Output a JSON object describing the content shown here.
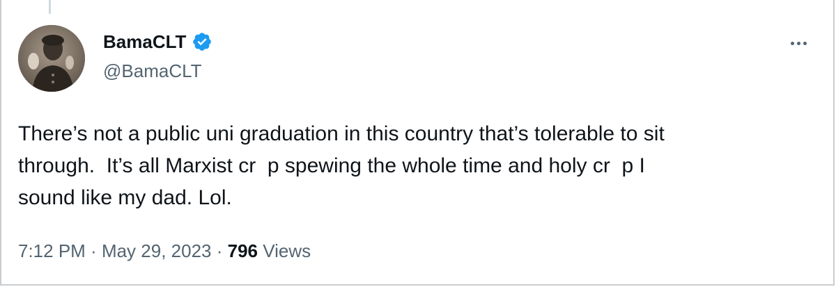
{
  "author": {
    "display_name": "BamaCLT",
    "handle": "@BamaCLT",
    "verified": true,
    "verified_color": "#1d9bf0"
  },
  "tweet": {
    "lines": [
      "There’s not a public uni graduation in this country that’s tolerable to sit",
      "through.  It’s all Marxist cr  p spewing the whole time and holy cr  p I",
      "sound like my dad. Lol."
    ]
  },
  "meta": {
    "time": "7:12 PM",
    "separator": " · ",
    "date": "May 29, 2023",
    "views_count": "796",
    "views_label": " Views"
  },
  "icons": {
    "verified": "verified-badge-icon",
    "more": "more-options-icon"
  }
}
